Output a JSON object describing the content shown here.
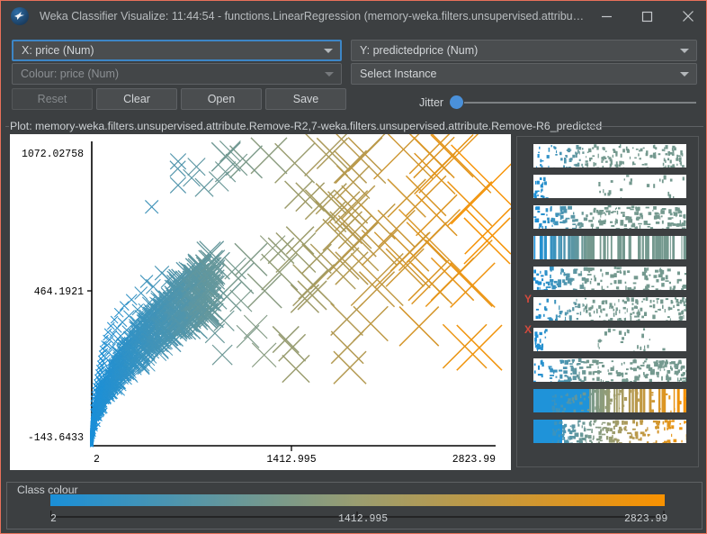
{
  "window": {
    "title": "Weka Classifier Visualize: 11:44:54 - functions.LinearRegression (memory-weka.filters.unsupervised.attribute.Remove...",
    "icon": "weka-bird-icon",
    "minimize_label": "minimize-icon",
    "maximize_label": "maximize-icon",
    "close_label": "close-icon"
  },
  "controls": {
    "x_axis": "X: price (Num)",
    "y_axis": "Y: predictedprice (Num)",
    "colour": "Colour: price (Num)",
    "instance": "Select Instance",
    "buttons": {
      "reset": "Reset",
      "clear": "Clear",
      "open": "Open",
      "save": "Save"
    },
    "jitter_label": "Jitter",
    "jitter_value": 0
  },
  "plot": {
    "label": "Plot: memory-weka.filters.unsupervised.attribute.Remove-R2,7-weka.filters.unsupervised.attribute.Remove-R6_predicted"
  },
  "legend": {
    "title": "Class colour",
    "min": "2",
    "mid": "1412.995",
    "max": "2823.99",
    "color_start": "#1a8fd8",
    "color_mid": "#9a9d70",
    "color_end": "#f99200"
  },
  "attribute_panel": {
    "y_tag": "Y",
    "x_tag": "X",
    "rows": 10
  },
  "chart_data": {
    "type": "scatter",
    "title": "Plot: memory-weka.filters.unsupervised.attribute.Remove-R2,7-weka.filters.unsupervised.attribute.Remove-R6_predicted",
    "xlabel": "price",
    "ylabel": "predictedprice",
    "xlim": [
      2,
      2823.99
    ],
    "ylim": [
      -143.6433,
      1072.02758
    ],
    "xticks": [
      "2",
      "1412.995",
      "2823.99"
    ],
    "yticks": [
      "-143.6433",
      "464.1921",
      "1072.02758"
    ],
    "grid": false,
    "marker": "x-cross",
    "colormap": {
      "low": "#1a8fd8",
      "mid": "#9a9d70",
      "high": "#f99200"
    },
    "color_encodes": "price",
    "note": "Marker size scales with instance value; dense blue cluster near low price, sparse large orange crosses at high price.",
    "points": [
      [
        12,
        10,
        3
      ],
      [
        14,
        26,
        3
      ],
      [
        16,
        45,
        3
      ],
      [
        18,
        8,
        3
      ],
      [
        20,
        62,
        3
      ],
      [
        22,
        34,
        3
      ],
      [
        24,
        80,
        3
      ],
      [
        26,
        18,
        3
      ],
      [
        28,
        52,
        3
      ],
      [
        30,
        96,
        3
      ],
      [
        32,
        40,
        3
      ],
      [
        34,
        70,
        3
      ],
      [
        36,
        110,
        3
      ],
      [
        38,
        25,
        3
      ],
      [
        40,
        88,
        3
      ],
      [
        42,
        130,
        3
      ],
      [
        44,
        58,
        3
      ],
      [
        46,
        102,
        3
      ],
      [
        48,
        150,
        3
      ],
      [
        50,
        72,
        3
      ],
      [
        52,
        120,
        3
      ],
      [
        54,
        168,
        3
      ],
      [
        56,
        92,
        3
      ],
      [
        58,
        140,
        3
      ],
      [
        60,
        185,
        3
      ],
      [
        62,
        110,
        3
      ],
      [
        64,
        160,
        3
      ],
      [
        66,
        205,
        3
      ],
      [
        68,
        128,
        3
      ],
      [
        70,
        178,
        3
      ],
      [
        72,
        225,
        3
      ],
      [
        74,
        148,
        3
      ],
      [
        76,
        196,
        3
      ],
      [
        78,
        245,
        3
      ],
      [
        80,
        165,
        3
      ],
      [
        84,
        215,
        3
      ],
      [
        88,
        265,
        3
      ],
      [
        92,
        185,
        3
      ],
      [
        96,
        235,
        3
      ],
      [
        100,
        288,
        3
      ],
      [
        104,
        205,
        4
      ],
      [
        110,
        258,
        4
      ],
      [
        116,
        310,
        4
      ],
      [
        122,
        228,
        4
      ],
      [
        128,
        280,
        4
      ],
      [
        136,
        335,
        4
      ],
      [
        144,
        250,
        4
      ],
      [
        152,
        302,
        4
      ],
      [
        160,
        360,
        4
      ],
      [
        170,
        272,
        4
      ],
      [
        180,
        326,
        5
      ],
      [
        192,
        388,
        5
      ],
      [
        204,
        295,
        5
      ],
      [
        216,
        350,
        5
      ],
      [
        230,
        415,
        5
      ],
      [
        246,
        318,
        5
      ],
      [
        262,
        375,
        6
      ],
      [
        280,
        440,
        6
      ],
      [
        300,
        340,
        6
      ],
      [
        322,
        400,
        6
      ],
      [
        346,
        466,
        7
      ],
      [
        372,
        362,
        7
      ],
      [
        400,
        425,
        7
      ],
      [
        432,
        492,
        8
      ],
      [
        466,
        385,
        8
      ],
      [
        502,
        450,
        9
      ],
      [
        542,
        520,
        9
      ],
      [
        586,
        408,
        10
      ],
      [
        634,
        475,
        11
      ],
      [
        686,
        548,
        12
      ],
      [
        742,
        430,
        13
      ],
      [
        804,
        500,
        14
      ],
      [
        872,
        575,
        15
      ],
      [
        946,
        452,
        16
      ],
      [
        1026,
        525,
        17
      ],
      [
        1114,
        600,
        18
      ],
      [
        1210,
        475,
        19
      ],
      [
        1314,
        550,
        20
      ],
      [
        1428,
        628,
        22
      ],
      [
        1552,
        498,
        23
      ],
      [
        1688,
        572,
        25
      ],
      [
        1836,
        652,
        27
      ],
      [
        1996,
        520,
        29
      ],
      [
        2172,
        598,
        31
      ],
      [
        2362,
        678,
        34
      ],
      [
        2568,
        545,
        37
      ],
      [
        2790,
        900,
        44
      ],
      [
        2540,
        1010,
        40
      ],
      [
        2180,
        1040,
        33
      ],
      [
        1880,
        1005,
        28
      ],
      [
        1640,
        1020,
        24
      ],
      [
        1420,
        985,
        22
      ],
      [
        1240,
        1015,
        20
      ],
      [
        1080,
        990,
        18
      ],
      [
        940,
        1010,
        16
      ]
    ]
  }
}
